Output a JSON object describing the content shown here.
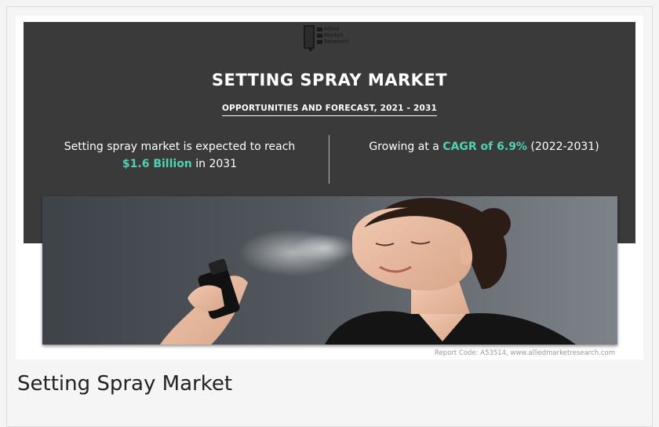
{
  "logo": {
    "line1": "Allied",
    "line2": "Market",
    "line3": "Research"
  },
  "infographic": {
    "title": "SETTING SPRAY MARKET",
    "subtitle": "OPPORTUNITIES AND FORECAST, 2021 - 2031",
    "stat_left": {
      "text_before": "Setting spray market is expected to reach",
      "highlight": "$1.6 Billion",
      "text_after": " in 2031"
    },
    "stat_right": {
      "text_before": "Growing at a ",
      "highlight": "CAGR of 6.9%",
      "text_after": " (2022-2031)"
    },
    "accent_color": "#4fd1b2",
    "report_code": "Report Code: A53514, www.alliedmarketresearch.com"
  },
  "caption": "Setting Spray Market"
}
